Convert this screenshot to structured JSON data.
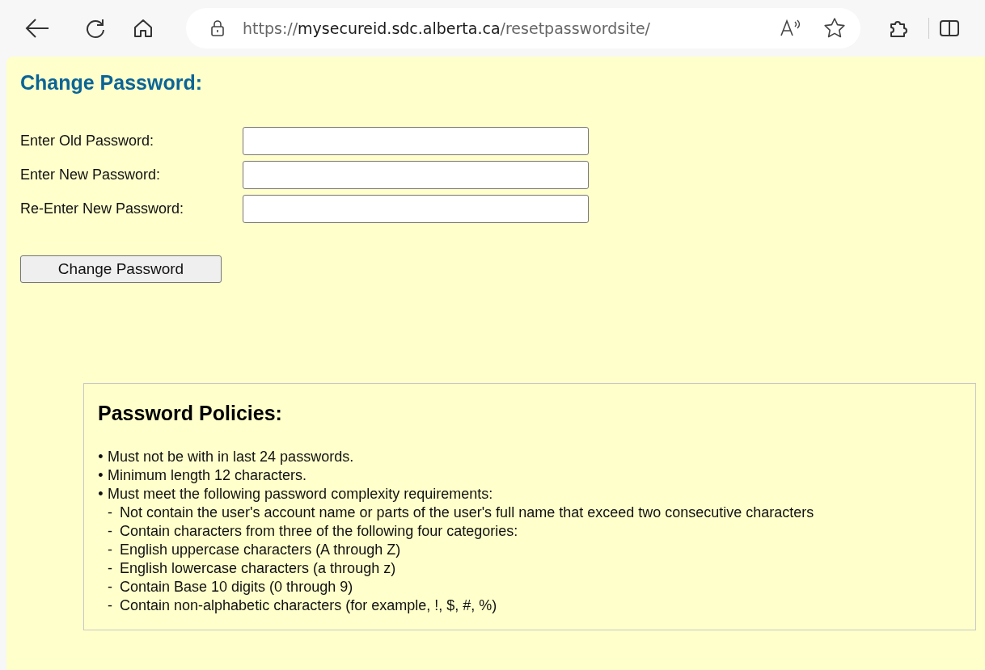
{
  "browser": {
    "address": {
      "scheme": "https://",
      "host": "mysecureid.sdc.alberta.ca",
      "path": "/resetpasswordsite/"
    }
  },
  "form": {
    "title": "Change Password:",
    "fields": [
      {
        "label": "Enter Old Password:"
      },
      {
        "label": "Enter New Password:"
      },
      {
        "label": "Re-Enter New Password:"
      }
    ],
    "button": "Change Password"
  },
  "policies": {
    "title": "Password Policies:",
    "items": [
      {
        "marker": "•",
        "text": "Must not be with in last 24 passwords."
      },
      {
        "marker": "•",
        "text": "Minimum length 12 characters."
      },
      {
        "marker": "•",
        "text": "Must meet the following password complexity requirements:"
      },
      {
        "marker": "-",
        "text": "Not contain the user's account name or parts of the user's full name that exceed two consecutive characters"
      },
      {
        "marker": "-",
        "text": "Contain characters from three of the following four categories:"
      },
      {
        "marker": "-",
        "text": "English uppercase characters (A through Z)"
      },
      {
        "marker": "-",
        "text": "English lowercase characters (a through z)"
      },
      {
        "marker": "-",
        "text": "Contain Base 10 digits (0 through 9)"
      },
      {
        "marker": "-",
        "text": "Contain non-alphabetic characters (for example, !, $, #, %)"
      }
    ]
  }
}
